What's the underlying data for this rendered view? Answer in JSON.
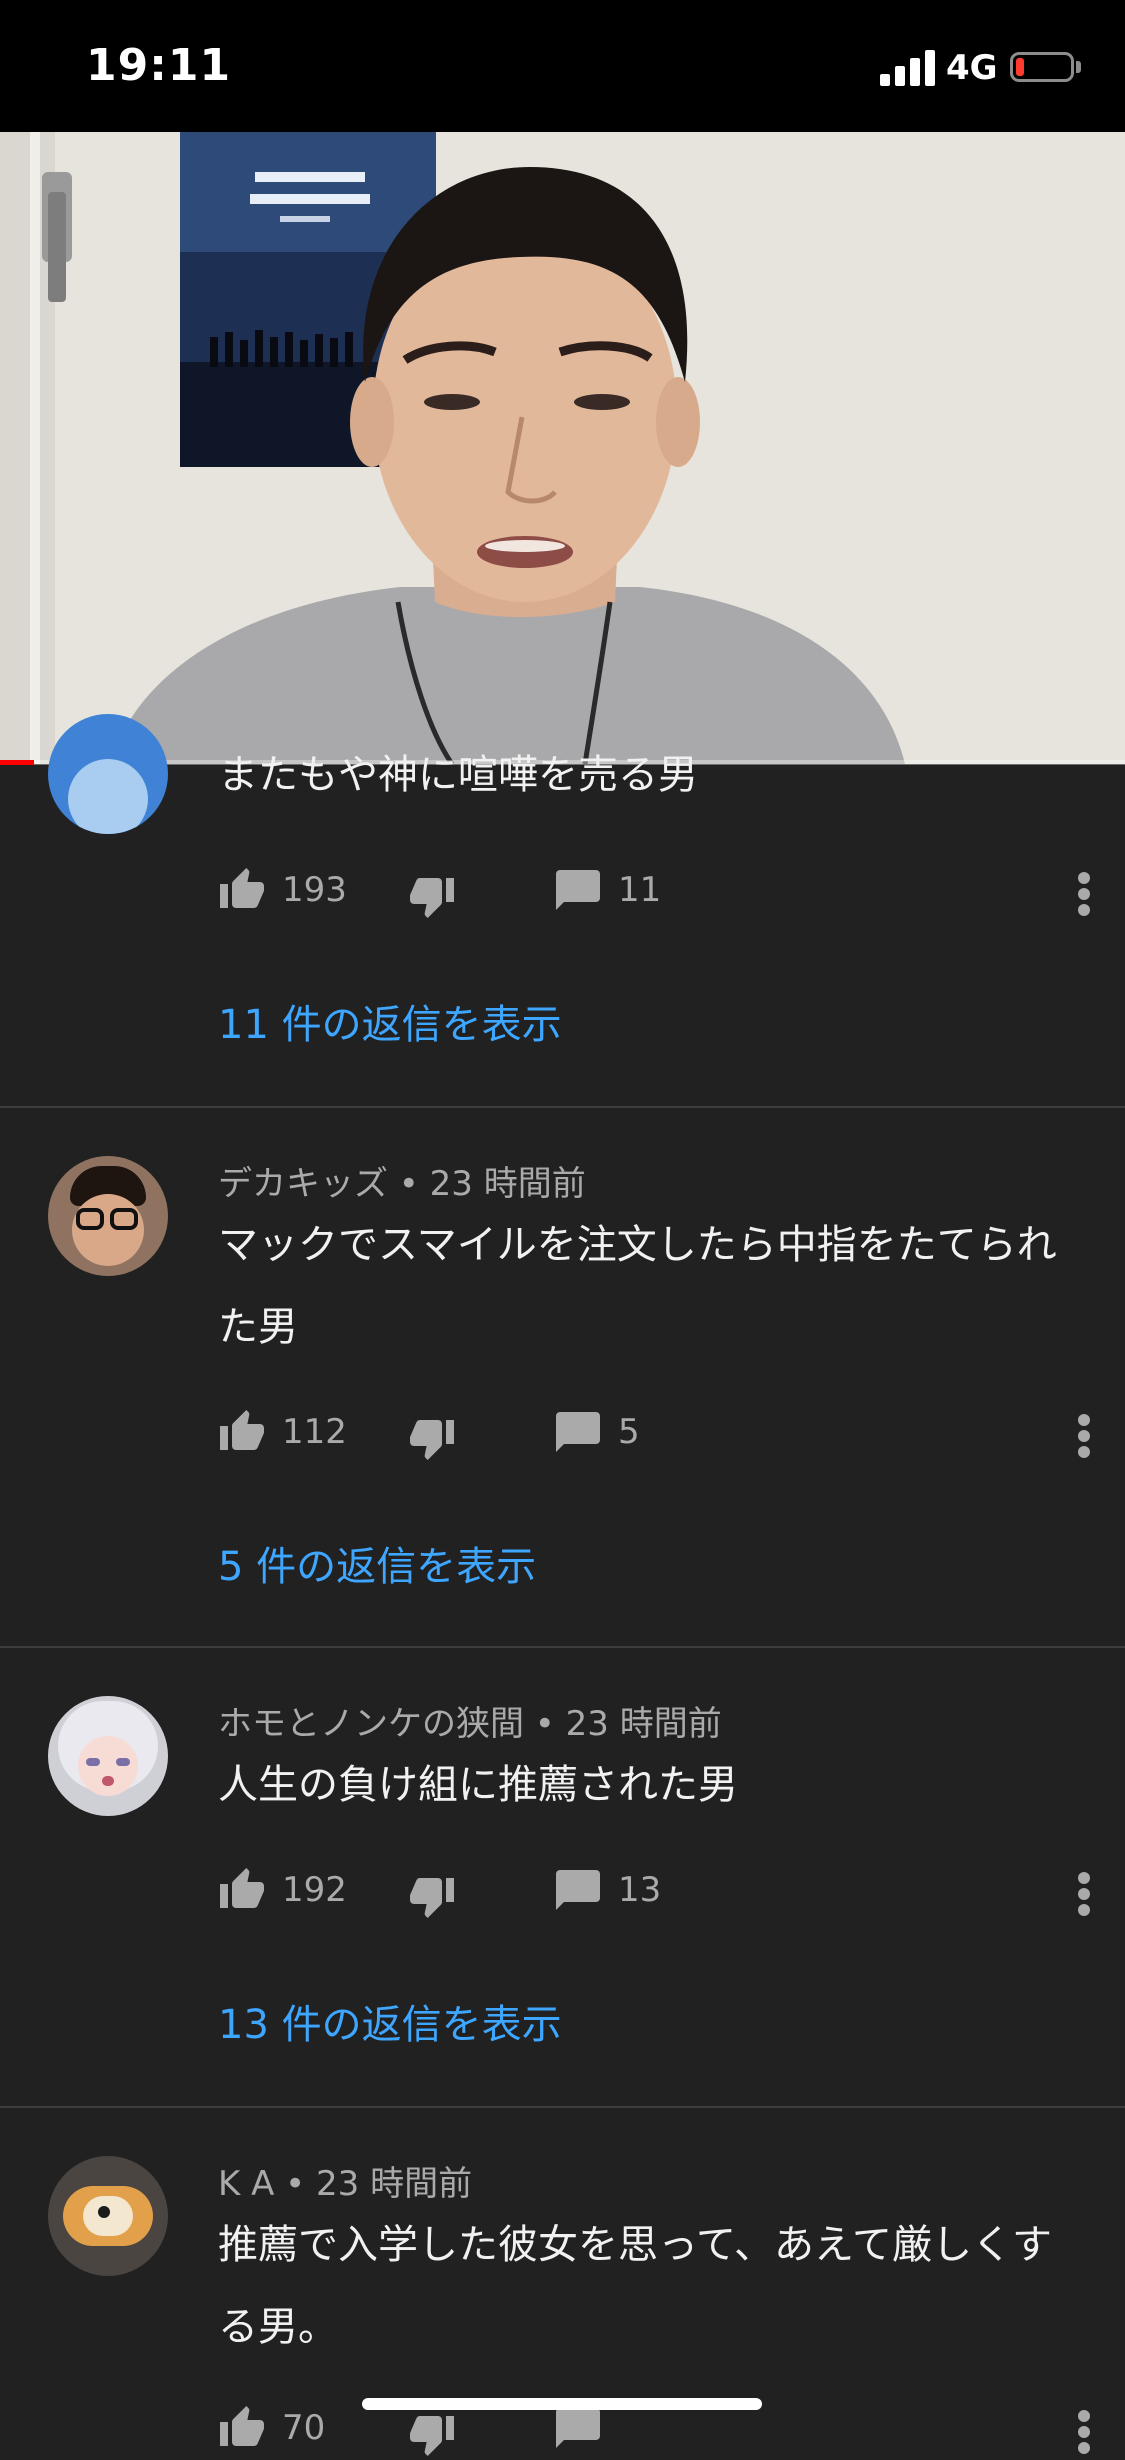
{
  "status_bar": {
    "time": "19:11",
    "network": "4G"
  },
  "video": {
    "progress_fraction": 0.03
  },
  "comments": [
    {
      "author": "",
      "time": "",
      "text": "またもや神に喧嘩を売る男",
      "likes": "193",
      "replies_count": "11",
      "replies_link": "11 件の返信を表示"
    },
    {
      "author": "デカキッズ",
      "time": "23 時間前",
      "text": "マックでスマイルを注文したら中指をたてられた男",
      "likes": "112",
      "replies_count": "5",
      "replies_link": "5 件の返信を表示"
    },
    {
      "author": "ホモとノンケの狭間",
      "time": "23 時間前",
      "text": "人生の負け組に推薦された男",
      "likes": "192",
      "replies_count": "13",
      "replies_link": "13 件の返信を表示"
    },
    {
      "author": "K A",
      "time": "23 時間前",
      "text": "推薦で入学した彼女を思って、あえて厳しくする男。",
      "likes": "70",
      "replies_count": "",
      "replies_link": ""
    }
  ],
  "separator": " • ",
  "colors": {
    "background": "#212121",
    "link": "#3ea6ff",
    "muted_text": "#aaaaaa",
    "progress": "#ff0000"
  },
  "icons": {
    "like": "thumb-up-icon",
    "dislike": "thumb-down-icon",
    "reply": "comment-icon",
    "more": "more-vertical-icon"
  }
}
